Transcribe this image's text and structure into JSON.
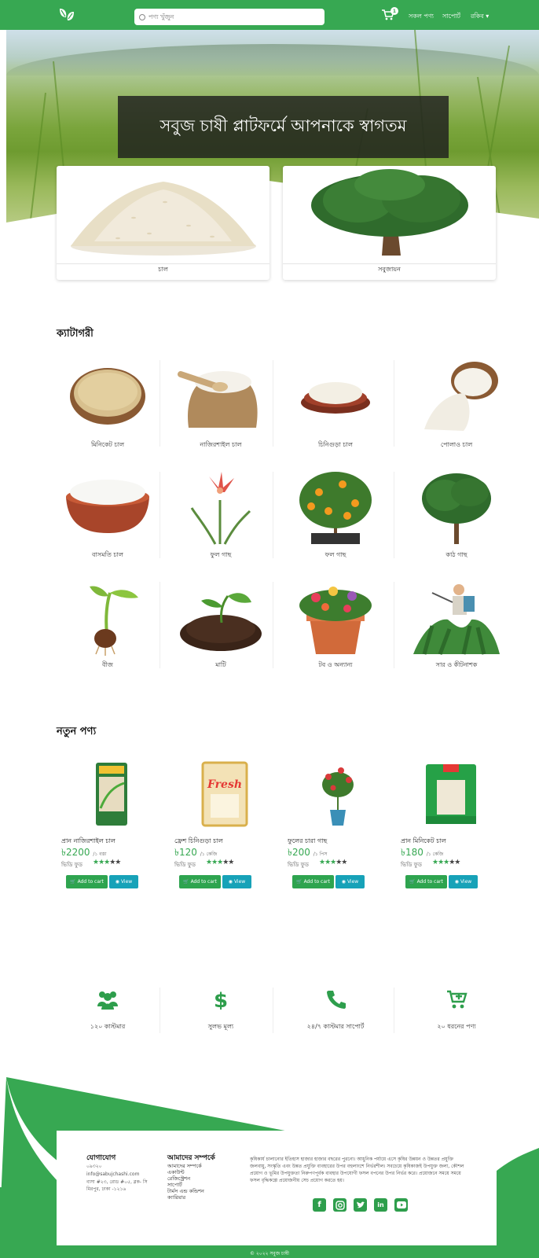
{
  "colors": {
    "brand": "#37a852",
    "info": "#17a2b8",
    "dark_overlay": "#1e1e1e"
  },
  "navbar": {
    "search_placeholder": "পণ্য খুঁজুন",
    "cart_count": "1",
    "links": [
      "সকল পণ্য",
      "সাপোর্ট",
      "রকিব ▾"
    ]
  },
  "hero": {
    "welcome": "সবুজ চাষী প্লাটফর্মে আপনাকে স্বাগতম",
    "cards": [
      "চাল",
      "সবুজায়ন"
    ]
  },
  "categories": {
    "title": "ক্যাটাগরী",
    "items": [
      "মিনিকেট চাল",
      "নাজিরশাইল চাল",
      "চিনিগুড়া চাল",
      "পোলাও চাল",
      "বাসমতি চাল",
      "ফুল গাছ",
      "ফল গাছ",
      "কাঠ গাছ",
      "বীজ",
      "মাটি",
      "টব ও অন্যান্য",
      "সার ও কীটনাশক"
    ]
  },
  "products": {
    "title": "নতুন পণ্য",
    "items": [
      {
        "name": "প্রান নাজিরশাইল চাল",
        "price": "৳2200",
        "unit": "/১ বস্তা",
        "seller": "ভিডি ফুড",
        "rating": 3
      },
      {
        "name": "ফ্রেশ চিনিগুড়া চাল",
        "price": "৳120",
        "unit": "/১ কেজি",
        "seller": "ভিডি ফুড",
        "rating": 3
      },
      {
        "name": "ফুলের চারা গাছ",
        "price": "৳200",
        "unit": "/১ পিস",
        "seller": "ভিডি ফুড",
        "rating": 3
      },
      {
        "name": "প্রান মিনিকেট চাল",
        "price": "৳180",
        "unit": "/১ কেজি",
        "seller": "ভিডি ফুড",
        "rating": 3
      }
    ],
    "add_to_cart": "Add to cart",
    "view": "View"
  },
  "stats": [
    "১২০ কাস্টমার",
    "সুলভ মূল্য",
    "২৪/৭ কাস্টমার সাপোর্ট",
    "২০ ধরনের পণ্য"
  ],
  "footer": {
    "contact_title": "যোগাযোগ",
    "contact_lines": [
      "০৯৩২০",
      "info@sabujchashi.com",
      "বাসা #২৩, রোড #০৫, ব্লক- সি",
      "মিরপুর, ঢাকা -১২১৬"
    ],
    "about_title": "আমাদের সম্পর্কে",
    "about_links": [
      "আমাদের সম্পর্কে",
      "একাউন্ট",
      "রেজিস্ট্রেশন",
      "সাপোর্ট",
      "টার্মস এন্ড কন্ডিশন",
      "ক্যারিয়ার"
    ],
    "about_text": "কৃষিকার্য চালানোর ইতিহাস হাজার হাজার বছরের পুরনো। আধুনিক পর্যায়ে এসে কৃষির উন্নয়ন ও উন্নতর প্রযুক্তি জলবায়ু, সংস্কৃতি এবং উন্নত প্রযুক্তি ব্যবহারের উপর বহুলাংশে নির্ভরশীল। সবচেয়ে কৃষিকাজই উপযুক্ত জলা, কৌশল প্রয়োগ ও ভূমির উপযুক্ততা নিরুপণপূর্বক ব্যবহার উপযোগী ফসল বপনের উপর নির্ভর করে। প্রয়োজনে সময়ে সময়ে ফসল বৃদ্ধিকল্পে প্রয়োজনীয় সেচ প্রয়োগ করতে হয়।",
    "copyright": "© ২০২২ সবুজ চাষী"
  }
}
